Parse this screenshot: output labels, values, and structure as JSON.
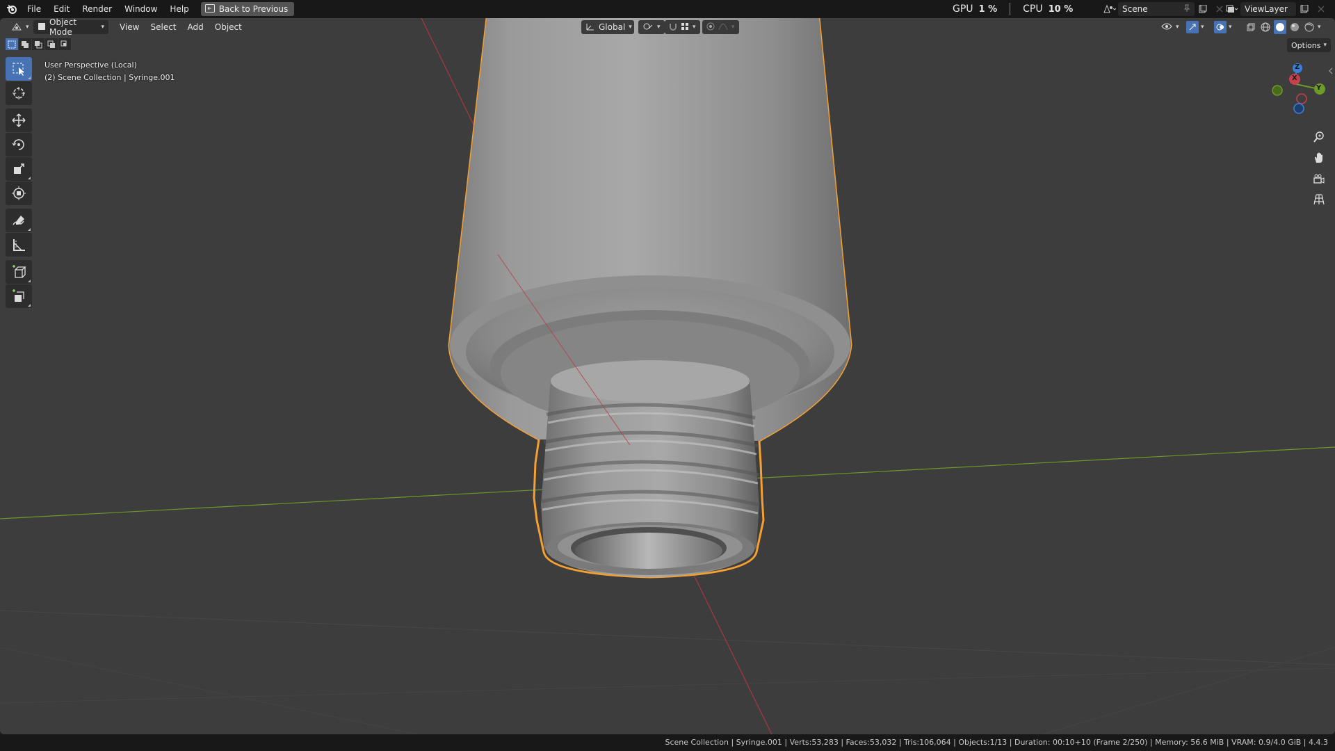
{
  "menu": {
    "file": "File",
    "edit": "Edit",
    "render": "Render",
    "window": "Window",
    "help": "Help",
    "back_to_previous": "Back to Previous"
  },
  "stats": {
    "gpu_label": "GPU",
    "gpu_value": "1 %",
    "cpu_label": "CPU",
    "cpu_value": "10 %"
  },
  "scene": {
    "name": "Scene"
  },
  "view_layer": {
    "name": "ViewLayer"
  },
  "viewport_header": {
    "mode": "Object Mode",
    "view": "View",
    "select": "Select",
    "add": "Add",
    "object": "Object",
    "transform_orientation": "Global",
    "options": "Options"
  },
  "overlay": {
    "perspective": "User Perspective (Local)",
    "collection": "(2) Scene Collection | Syringe.001"
  },
  "gizmo": {
    "x": "X",
    "y": "Y",
    "z": "Z"
  },
  "toolbar": {
    "tools": [
      "select-box",
      "cursor",
      "move",
      "rotate",
      "scale",
      "transform",
      "annotate",
      "measure",
      "add-cube",
      "add-primitive"
    ],
    "active": "select-box"
  },
  "status_bar": {
    "text": "Scene Collection | Syringe.001 | Verts:53,283 | Faces:53,032 | Tris:106,064 | Objects:1/13 | Duration: 00:10+10 (Frame 2/250) | Memory: 56.6 MiB | VRAM: 0.9/4.0 GiB | 4.4.3"
  },
  "colors": {
    "accent": "#4772b3",
    "selection_outline": "#f5a030",
    "x_axis": "#c8404e",
    "y_axis": "#6e9a28",
    "z_axis": "#3d7fd6"
  }
}
